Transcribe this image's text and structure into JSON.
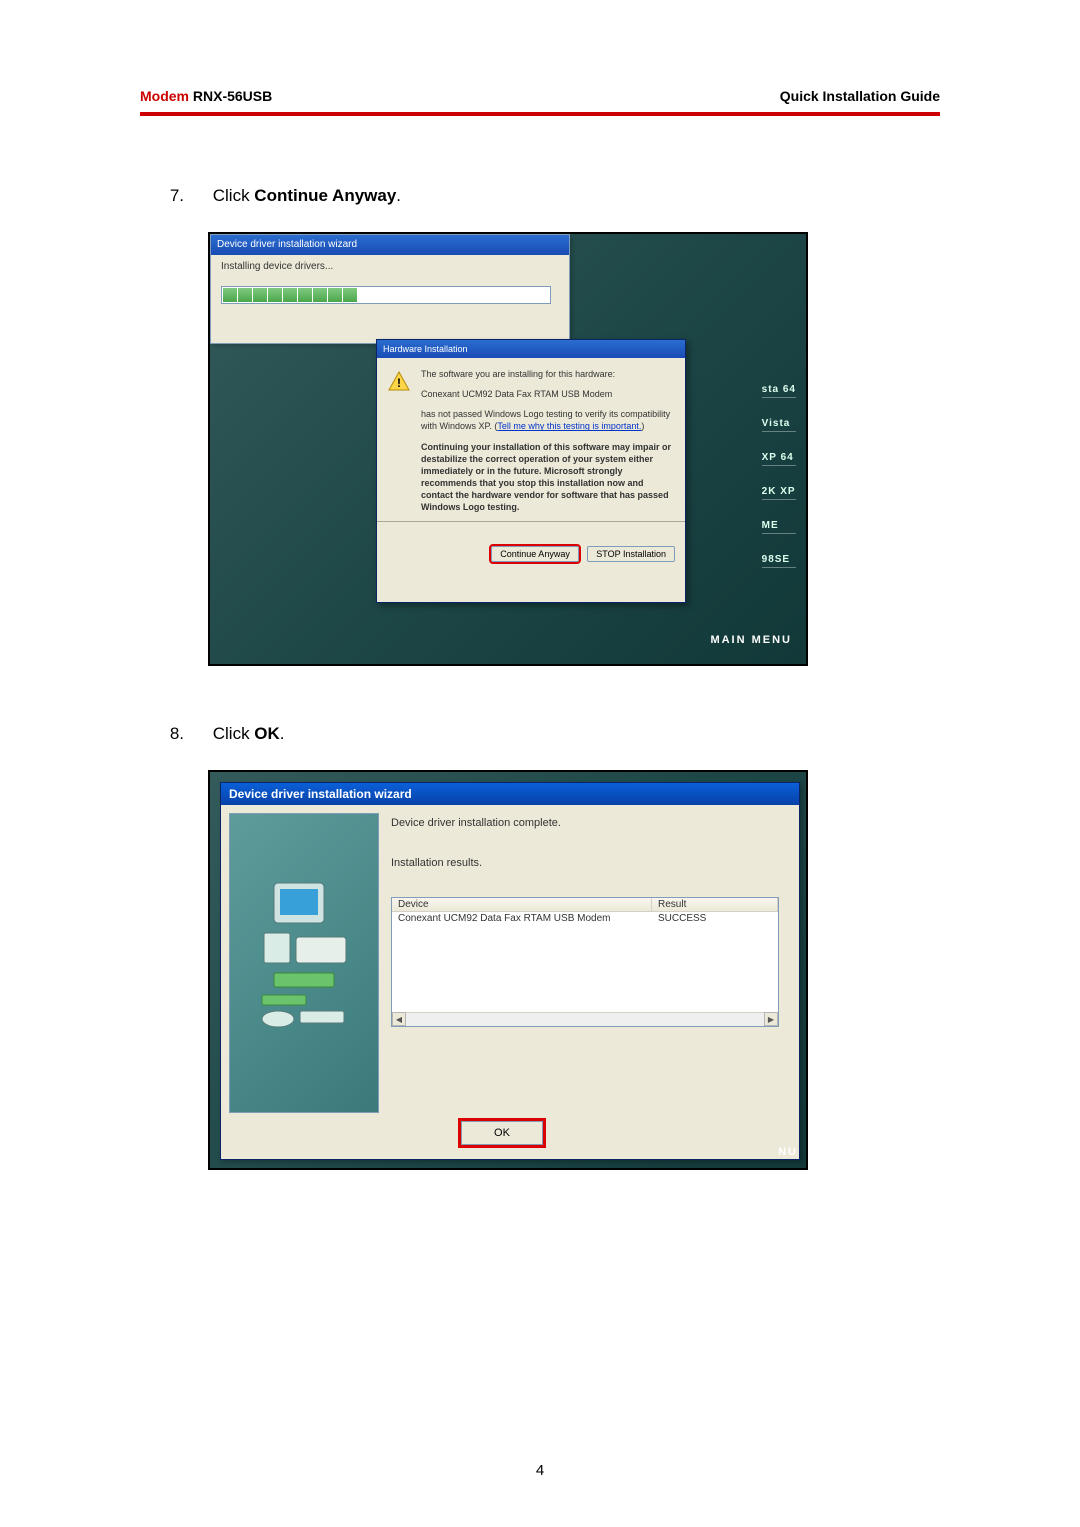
{
  "header": {
    "brand": "Modem",
    "model": "RNX-56USB",
    "guide": "Quick  Installation  Guide"
  },
  "step7": {
    "number": "7.",
    "prefix": "Click ",
    "bold": "Continue Anyway",
    "suffix": "."
  },
  "screenshot1": {
    "install_title": "Device driver installation wizard",
    "install_body": "Installing device drivers...",
    "hw_title": "Hardware Installation",
    "hw_line1": "The software you are installing for this hardware:",
    "hw_device": "Conexant UCM92 Data Fax RTAM USB Modem",
    "hw_line2a": "has not passed Windows Logo testing to verify its compatibility with Windows XP. (",
    "hw_link": "Tell me why this testing is important.",
    "hw_line2b": ")",
    "hw_line3": "Continuing your installation of this software may impair or destabilize the correct operation of your system either immediately or in the future. Microsoft strongly recommends that you stop this installation now and contact the hardware vendor for software that has passed Windows Logo testing.",
    "btn_continue": "Continue Anyway",
    "btn_stop": "STOP Installation",
    "side": [
      "sta 64",
      "Vista",
      "XP 64",
      "2K  XP",
      "ME",
      "98SE"
    ],
    "main_menu": "MAIN  MENU"
  },
  "step8": {
    "number": "8.",
    "prefix": "Click ",
    "bold": "OK",
    "suffix": "."
  },
  "screenshot2": {
    "title": "Device driver installation wizard",
    "p1": "Device driver installation complete.",
    "p2": "Installation results.",
    "col1": "Device",
    "col2": "Result",
    "row_device": "Conexant UCM92 Data Fax RTAM USB Modem",
    "row_result": "SUCCESS",
    "ok": "OK",
    "nu": "NU"
  },
  "page_number": "4"
}
